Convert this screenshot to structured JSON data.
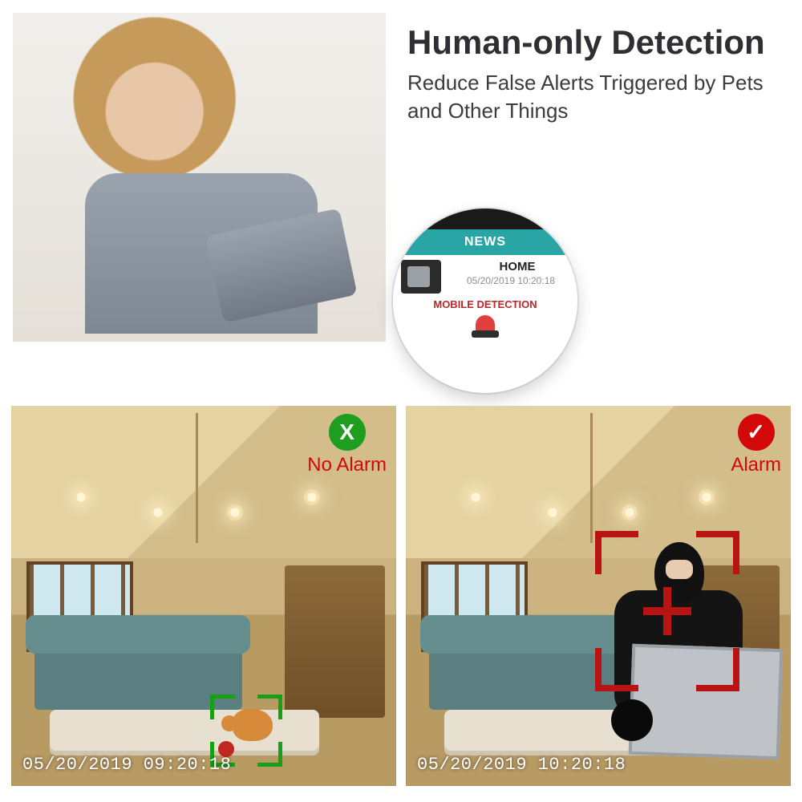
{
  "headline": {
    "title": "Human-only Detection",
    "subtitle": "Reduce False Alerts Triggered by Pets and Other Things"
  },
  "notification": {
    "banner": "NEWS",
    "location": "HOME",
    "timestamp": "05/20/2019 10:20:18",
    "type": "MOBILE DETECTION"
  },
  "panels": {
    "no_alarm": {
      "badge_glyph": "X",
      "label": "No Alarm",
      "timestamp": "05/20/2019 09:20:18"
    },
    "alarm": {
      "badge_glyph": "✓",
      "label": "Alarm",
      "timestamp": "05/20/2019 10:20:18"
    }
  },
  "colors": {
    "ok": "#1f9d1f",
    "alert": "#d30808",
    "news_bar": "#2aa5a5"
  }
}
